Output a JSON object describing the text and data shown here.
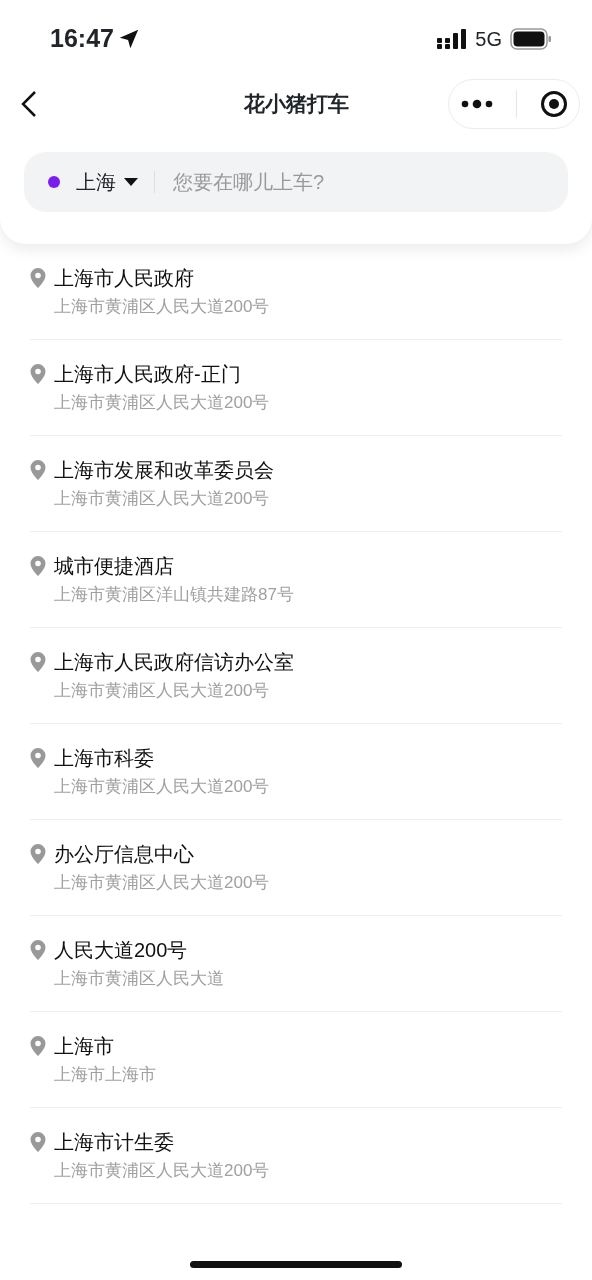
{
  "status_bar": {
    "time": "16:47",
    "network": "5G"
  },
  "nav": {
    "title": "花小猪打车"
  },
  "search": {
    "city": "上海",
    "placeholder": "您要在哪儿上车?"
  },
  "places": [
    {
      "name": "上海市人民政府",
      "address": "上海市黄浦区人民大道200号"
    },
    {
      "name": "上海市人民政府-正门",
      "address": "上海市黄浦区人民大道200号"
    },
    {
      "name": "上海市发展和改革委员会",
      "address": "上海市黄浦区人民大道200号"
    },
    {
      "name": "城市便捷酒店",
      "address": "上海市黄浦区洋山镇共建路87号"
    },
    {
      "name": "上海市人民政府信访办公室",
      "address": "上海市黄浦区人民大道200号"
    },
    {
      "name": "上海市科委",
      "address": "上海市黄浦区人民大道200号"
    },
    {
      "name": "办公厅信息中心",
      "address": "上海市黄浦区人民大道200号"
    },
    {
      "name": "人民大道200号",
      "address": "上海市黄浦区人民大道"
    },
    {
      "name": "上海市",
      "address": "上海市上海市"
    },
    {
      "name": "上海市计生委",
      "address": "上海市黄浦区人民大道200号"
    }
  ]
}
